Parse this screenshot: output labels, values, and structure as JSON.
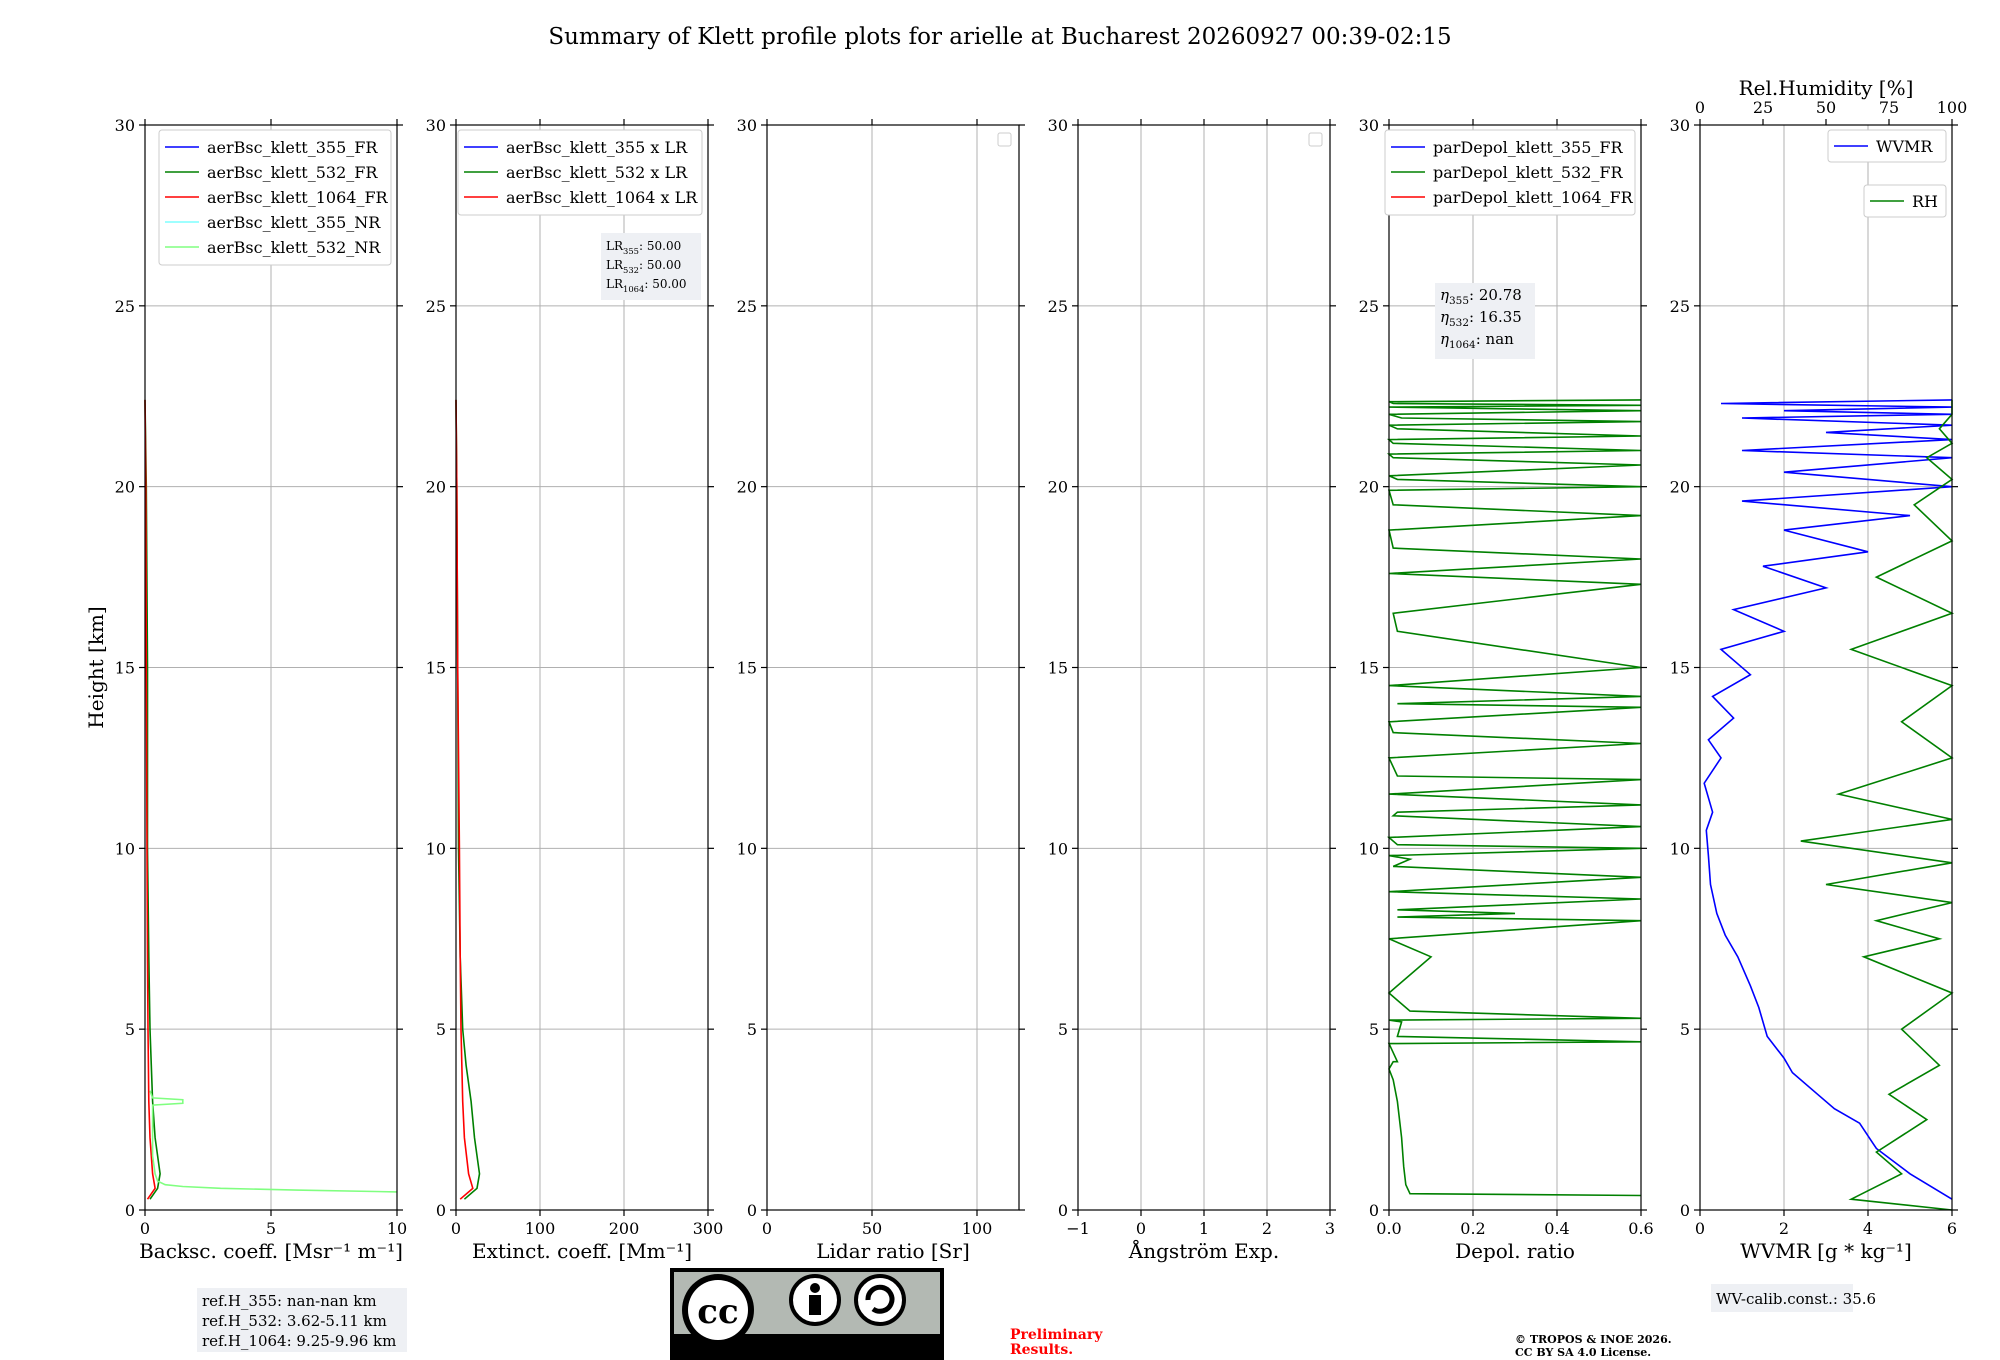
{
  "figure": {
    "title": "Summary of Klett profile plots for arielle at Bucharest 20260927 00:39-02:15",
    "preliminary": [
      "Preliminary",
      "Results."
    ],
    "copyright": [
      "© TROPOS & INOE 2026.",
      "CC BY SA 4.0 License."
    ],
    "license_badge": {
      "icon_text": "cc",
      "left": "BY",
      "right": "SA"
    },
    "wv_calib": "WV-calib.const.: 35.6",
    "refh": [
      "ref.H_355: nan-nan km",
      "ref.H_532: 3.62-5.11 km",
      "ref.H_1064: 9.25-9.96 km"
    ],
    "colors": {
      "blue": "#0000ff",
      "green": "#008000",
      "red": "#ff0000",
      "cyan": "#7fffff",
      "lightgreen": "#80ff80",
      "preliminary": "#ff0000"
    }
  },
  "chart_data": [
    {
      "type": "line",
      "panel": "backscatter",
      "xlabel": "Backsc. coeff. [Msr⁻¹ m⁻¹]",
      "ylabel": "Height [km]",
      "xlim": [
        0,
        10
      ],
      "ylim": [
        0,
        30
      ],
      "xticks": [
        0,
        5,
        10
      ],
      "yticks": [
        0,
        5,
        10,
        15,
        20,
        25,
        30
      ],
      "grid": true,
      "legend": "top-right",
      "series": [
        {
          "name": "aerBsc_klett_355_FR",
          "color": "#0000ff",
          "x": [],
          "y": []
        },
        {
          "name": "aerBsc_klett_532_FR",
          "color": "#008000",
          "x": [
            0.2,
            0.5,
            0.6,
            0.4,
            0.3,
            0.25,
            0.2,
            0.15,
            0.1,
            0.1,
            0.05,
            0.0
          ],
          "y": [
            0.3,
            0.6,
            1.0,
            2.0,
            3.0,
            4.0,
            5.0,
            7.0,
            10.0,
            15.0,
            20.0,
            22.4
          ]
        },
        {
          "name": "aerBsc_klett_1064_FR",
          "color": "#ff0000",
          "x": [
            0.1,
            0.4,
            0.3,
            0.2,
            0.15,
            0.12,
            0.1,
            0.08,
            0.05,
            0.03,
            0.0
          ],
          "y": [
            0.3,
            0.6,
            1.0,
            2.0,
            3.0,
            5.0,
            7.0,
            10.0,
            15.0,
            20.0,
            22.4
          ]
        },
        {
          "name": "aerBsc_klett_355_NR",
          "color": "#7fffff",
          "x": [],
          "y": []
        },
        {
          "name": "aerBsc_klett_532_NR",
          "color": "#80ff80",
          "x": [
            10,
            6,
            3,
            1.5,
            0.8,
            0.5,
            0.4,
            0.3,
            0.3,
            0.3,
            1.5,
            1.5,
            0.3,
            0.2
          ],
          "y": [
            0.5,
            0.55,
            0.6,
            0.65,
            0.7,
            0.8,
            1.0,
            1.5,
            2.5,
            2.9,
            2.95,
            3.05,
            3.1,
            3.3
          ]
        }
      ],
      "textbox": null
    },
    {
      "type": "line",
      "panel": "extinction",
      "xlabel": "Extinct. coeff. [Mm⁻¹]",
      "ylabel": "",
      "xlim": [
        0,
        300
      ],
      "ylim": [
        0,
        30
      ],
      "xticks": [
        0,
        100,
        200,
        300
      ],
      "yticks": [
        0,
        5,
        10,
        15,
        20,
        25,
        30
      ],
      "grid": true,
      "legend": "top-right",
      "series": [
        {
          "name": "aerBsc_klett_355 x LR",
          "color": "#0000ff",
          "x": [],
          "y": []
        },
        {
          "name": "aerBsc_klett_532 x LR",
          "color": "#008000",
          "x": [
            10,
            25,
            28,
            22,
            18,
            12,
            8,
            5,
            3,
            2,
            1,
            0
          ],
          "y": [
            0.3,
            0.6,
            1.0,
            2.0,
            3.0,
            4.0,
            5.0,
            7.0,
            10.0,
            15.0,
            20.0,
            22.4
          ]
        },
        {
          "name": "aerBsc_klett_1064 x LR",
          "color": "#ff0000",
          "x": [
            5,
            20,
            15,
            10,
            8,
            6,
            5,
            4,
            2,
            1,
            0
          ],
          "y": [
            0.3,
            0.6,
            1.0,
            2.0,
            3.0,
            5.0,
            7.0,
            10.0,
            15.0,
            20.0,
            22.4
          ]
        }
      ],
      "textbox": {
        "lines": [
          {
            "base": "LR",
            "sub": "355",
            "val": ": 50.00"
          },
          {
            "base": "LR",
            "sub": "532",
            "val": ": 50.00"
          },
          {
            "base": "LR",
            "sub": "1064",
            "val": ": 50.00"
          }
        ]
      }
    },
    {
      "type": "line",
      "panel": "lidar_ratio",
      "xlabel": "Lidar ratio [Sr]",
      "ylabel": "",
      "xlim": [
        0,
        120
      ],
      "ylim": [
        0,
        30
      ],
      "xticks": [
        0,
        50,
        100
      ],
      "yticks": [
        0,
        5,
        10,
        15,
        20,
        25,
        30
      ],
      "grid": true,
      "legend": "empty",
      "series": [],
      "textbox": null
    },
    {
      "type": "line",
      "panel": "angstrom",
      "xlabel": "Ångström Exp.",
      "ylabel": "",
      "xlim": [
        -1,
        3
      ],
      "ylim": [
        0,
        30
      ],
      "xticks": [
        -1,
        0,
        1,
        2,
        3
      ],
      "yticks": [
        0,
        5,
        10,
        15,
        20,
        25,
        30
      ],
      "grid": true,
      "legend": "empty",
      "series": [],
      "textbox": null
    },
    {
      "type": "line",
      "panel": "depol",
      "xlabel": "Depol. ratio",
      "ylabel": "",
      "xlim": [
        0.0,
        0.6
      ],
      "ylim": [
        0,
        30
      ],
      "xticks": [
        0.0,
        0.2,
        0.4,
        0.6
      ],
      "xticklabels": [
        "0.0",
        "0.2",
        "0.4",
        "0.6"
      ],
      "yticks": [
        0,
        5,
        10,
        15,
        20,
        25,
        30
      ],
      "grid": true,
      "legend": "top-right",
      "series": [
        {
          "name": "parDepol_klett_355_FR",
          "color": "#0000ff",
          "x": [],
          "y": []
        },
        {
          "name": "parDepol_klett_532_FR",
          "color": "#008000",
          "x": [
            0.6,
            0.05,
            0.04,
            0.035,
            0.03,
            0.02,
            0.01,
            0.0,
            0.01,
            0.02,
            0.0,
            0.6,
            0.02,
            0.03,
            0.0,
            0.6,
            0.05,
            0.0,
            0.1,
            0.0,
            0.6,
            0.02,
            0.3,
            0.02,
            0.6,
            0.0,
            0.6,
            0.01,
            0.05,
            0.0,
            0.6,
            0.02,
            0.0,
            0.6,
            0.01,
            0.02,
            0.6,
            0.0,
            0.6,
            0.02,
            0.0,
            0.6,
            0.01,
            0.0,
            0.6,
            0.02,
            0.6,
            0.0,
            0.6,
            0.02,
            0.01,
            0.6,
            0.0,
            0.6,
            0.01,
            0.0,
            0.6,
            0.01,
            0.0,
            0.6,
            0.02,
            0.0,
            0.6,
            0.01,
            0.0,
            0.6,
            0.01,
            0.0,
            0.6,
            0.02,
            0.0,
            0.6,
            0.03,
            0.0,
            0.6,
            0.0,
            0.6,
            0.01,
            0.0,
            0.6
          ],
          "y": [
            0.4,
            0.45,
            0.7,
            1.2,
            2.0,
            3.0,
            3.6,
            3.9,
            4.1,
            4.1,
            4.6,
            4.65,
            4.8,
            5.2,
            5.25,
            5.3,
            5.5,
            6.0,
            7.0,
            7.5,
            8.0,
            8.1,
            8.2,
            8.3,
            8.6,
            8.8,
            9.2,
            9.5,
            9.7,
            9.8,
            10.0,
            10.1,
            10.3,
            10.6,
            10.9,
            11.0,
            11.2,
            11.5,
            11.9,
            12.0,
            12.5,
            12.9,
            13.2,
            13.5,
            13.9,
            14.0,
            14.2,
            14.5,
            15.0,
            16.0,
            16.5,
            17.3,
            17.6,
            18.0,
            18.3,
            18.8,
            19.2,
            19.5,
            19.9,
            20.0,
            20.2,
            20.3,
            20.6,
            20.8,
            20.9,
            21.0,
            21.2,
            21.3,
            21.4,
            21.6,
            21.7,
            21.8,
            21.9,
            22.0,
            22.1,
            22.2,
            22.25,
            22.3,
            22.35,
            22.4
          ]
        },
        {
          "name": "parDepol_klett_1064_FR",
          "color": "#ff0000",
          "x": [],
          "y": []
        }
      ],
      "textbox": {
        "lines": [
          {
            "base": "η",
            "sub": "355",
            "val": ": 20.78"
          },
          {
            "base": "η",
            "sub": "532",
            "val": ": 16.35"
          },
          {
            "base": "η",
            "sub": "1064",
            "val": ": nan"
          }
        ]
      }
    },
    {
      "type": "line",
      "panel": "wvmr",
      "xlabel": "WVMR [g * kg⁻¹]",
      "ylabel": "",
      "top_xlabel": "Rel.Humidity [%]",
      "xlim": [
        0,
        6
      ],
      "top_xlim": [
        0,
        100
      ],
      "ylim": [
        0,
        30
      ],
      "xticks": [
        0,
        2,
        4,
        6
      ],
      "top_xticks": [
        0,
        25,
        50,
        75,
        100
      ],
      "yticks": [
        0,
        5,
        10,
        15,
        20,
        25,
        30
      ],
      "grid": true,
      "legend": "top-right",
      "series": [
        {
          "name": "WVMR",
          "color": "#0000ff",
          "axis": "bottom",
          "x": [
            6.0,
            5.0,
            4.2,
            3.8,
            3.2,
            2.8,
            2.2,
            2.0,
            1.6,
            1.4,
            1.2,
            0.9,
            0.6,
            0.4,
            0.25,
            0.2,
            0.15,
            0.3,
            0.1,
            0.5,
            0.2,
            0.8,
            0.3,
            1.2,
            0.5,
            2.0,
            0.8,
            3.0,
            1.5,
            4.0,
            2.0,
            5.0,
            1.0,
            6.0,
            2.0,
            6.0,
            1.0,
            6.0,
            3.0,
            6.0,
            1.0,
            6.0,
            2.0,
            6.0,
            0.5,
            6.0
          ],
          "y": [
            0.3,
            1.0,
            1.7,
            2.4,
            2.8,
            3.2,
            3.8,
            4.2,
            4.8,
            5.6,
            6.2,
            7.0,
            7.6,
            8.2,
            9.0,
            9.8,
            10.5,
            11.0,
            11.8,
            12.5,
            13.0,
            13.6,
            14.2,
            14.8,
            15.5,
            16.0,
            16.6,
            17.2,
            17.8,
            18.2,
            18.8,
            19.2,
            19.6,
            20.0,
            20.4,
            20.8,
            21.0,
            21.3,
            21.5,
            21.7,
            21.9,
            22.0,
            22.1,
            22.2,
            22.3,
            22.4
          ]
        },
        {
          "name": "RH",
          "color": "#008000",
          "axis": "top",
          "x": [
            100,
            60,
            80,
            70,
            90,
            75,
            95,
            80,
            100,
            65,
            95,
            70,
            100,
            50,
            100,
            40,
            100,
            55,
            100,
            80,
            100,
            60,
            100,
            70,
            100,
            85,
            100,
            90,
            100,
            95,
            100,
            100
          ],
          "y": [
            0.0,
            0.3,
            1.0,
            1.6,
            2.5,
            3.2,
            4.0,
            5.0,
            6.0,
            7.0,
            7.5,
            8.0,
            8.5,
            9.0,
            9.6,
            10.2,
            10.8,
            11.5,
            12.5,
            13.5,
            14.5,
            15.5,
            16.5,
            17.5,
            18.5,
            19.5,
            20.2,
            20.8,
            21.2,
            21.6,
            22.0,
            22.4
          ]
        }
      ],
      "textbox": null
    }
  ]
}
